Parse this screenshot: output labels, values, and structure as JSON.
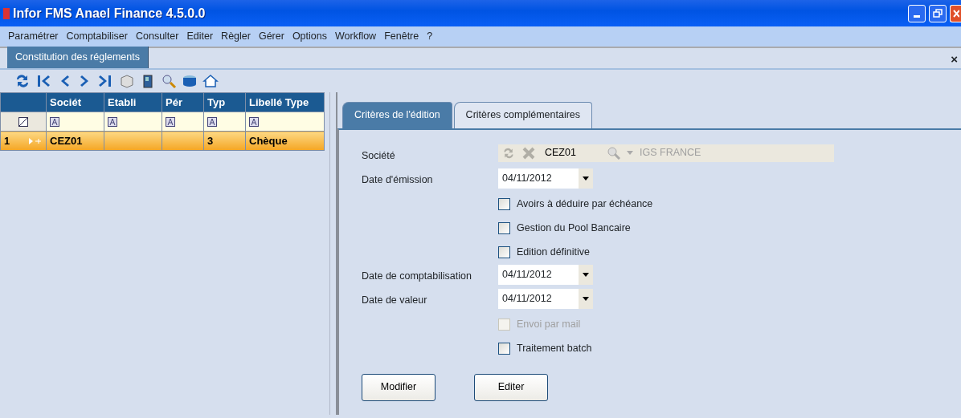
{
  "window": {
    "title": "Infor FMS Anael Finance 4.5.0.0"
  },
  "menu": [
    "Paramétrer",
    "Comptabiliser",
    "Consulter",
    "Editer",
    "Règler",
    "Gérer",
    "Options",
    "Workflow",
    "Fenêtre",
    "?"
  ],
  "document_tab": {
    "label": "Constitution des réglements",
    "close": "×"
  },
  "grid": {
    "columns": [
      "Sociét",
      "Etabli",
      "Pér",
      "Typ",
      "Libellé Type"
    ],
    "rows": [
      {
        "number": "1",
        "selected": true,
        "cells": [
          "CEZ01",
          "",
          "",
          "3",
          "Chèque"
        ]
      }
    ]
  },
  "tabs": [
    {
      "label": "Critères de l'édition",
      "selected": true
    },
    {
      "label": "Critères complémentaires",
      "selected": false
    }
  ],
  "fields": [
    {
      "kind": "lookup",
      "label": "Société",
      "code": "CEZ01",
      "name": "IGS FRANCE"
    },
    {
      "kind": "date",
      "label": "Date d'émission",
      "value": "04/11/2012"
    },
    {
      "kind": "checkbox",
      "label": "Avoirs à déduire par échéance",
      "checked": false,
      "disabled": false
    },
    {
      "kind": "checkbox",
      "label": "Gestion du Pool Bancaire",
      "checked": false,
      "disabled": false
    },
    {
      "kind": "checkbox",
      "label": "Edition définitive",
      "checked": false,
      "disabled": false
    },
    {
      "kind": "date",
      "label": "Date de comptabilisation",
      "value": "04/11/2012"
    },
    {
      "kind": "date",
      "label": "Date de valeur",
      "value": "04/11/2012"
    },
    {
      "kind": "checkbox",
      "label": "Envoi par mail",
      "checked": false,
      "disabled": true
    },
    {
      "kind": "checkbox",
      "label": "Traitement batch",
      "checked": false,
      "disabled": false
    }
  ],
  "buttons": [
    "Modifier",
    "Editer"
  ]
}
